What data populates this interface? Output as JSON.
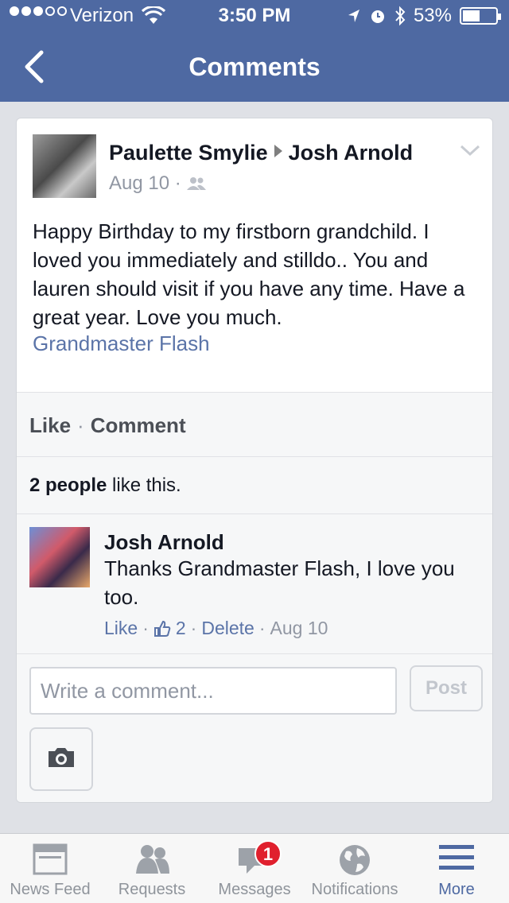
{
  "status": {
    "carrier": "Verizon",
    "time": "3:50 PM",
    "battery": "53%",
    "battery_level": 0.53
  },
  "nav": {
    "title": "Comments"
  },
  "post": {
    "author": "Paulette Smylie",
    "recipient": "Josh Arnold",
    "date": "Aug 10 ·",
    "text": "Happy Birthday to my firstborn grandchild. I loved you immediately and stilldo.. You and lauren should visit if you have any time. Have a great year. Love you much.",
    "link": "Grandmaster Flash"
  },
  "actions": {
    "like": "Like",
    "sep": "·",
    "comment": "Comment"
  },
  "likes": {
    "count": "2 people",
    "suffix": "like this."
  },
  "comment": {
    "author": "Josh Arnold",
    "text": "Thanks Grandmaster Flash, I love you too.",
    "like": "Like",
    "like_count": "2",
    "delete": "Delete",
    "date": "Aug 10"
  },
  "composer": {
    "placeholder": "Write a comment...",
    "post": "Post"
  },
  "tabs": [
    {
      "label": "News Feed",
      "icon": "news-feed-icon"
    },
    {
      "label": "Requests",
      "icon": "friend-requests-icon"
    },
    {
      "label": "Messages",
      "icon": "messages-icon",
      "badge": "1"
    },
    {
      "label": "Notifications",
      "icon": "globe-icon"
    },
    {
      "label": "More",
      "icon": "menu-icon"
    }
  ],
  "colors": {
    "brand": "#4e69a2",
    "link": "#5b74a8",
    "badge": "#e0202e"
  }
}
